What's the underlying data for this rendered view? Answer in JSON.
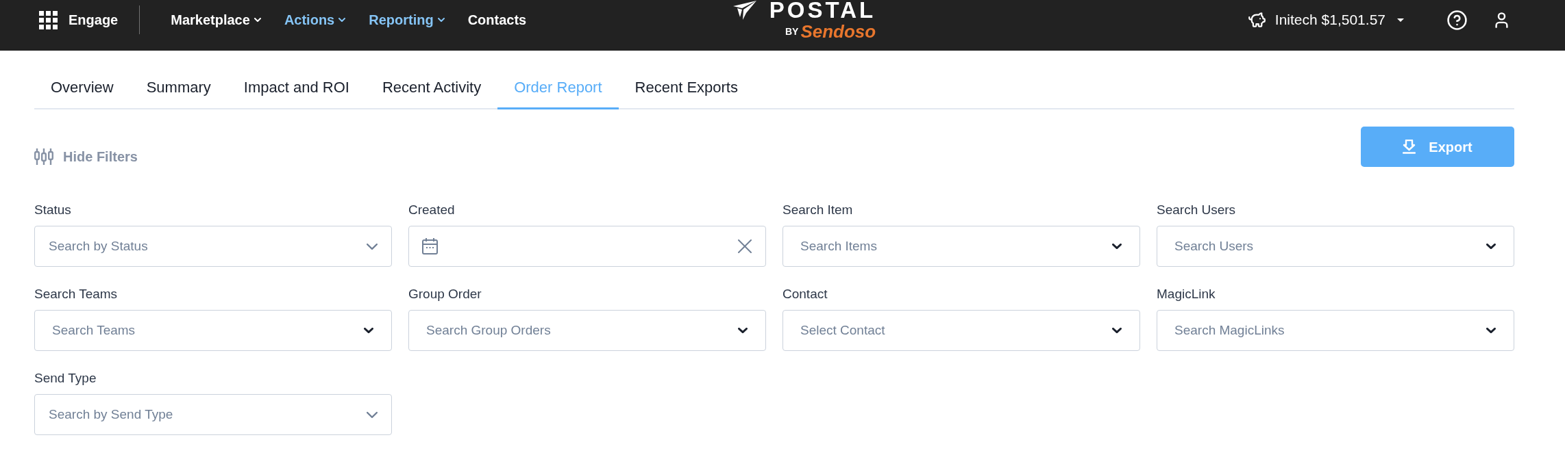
{
  "header": {
    "apps_label": "Engage",
    "nav": [
      {
        "label": "Marketplace",
        "active": false,
        "has_menu": true
      },
      {
        "label": "Actions",
        "active": true,
        "has_menu": true
      },
      {
        "label": "Reporting",
        "active": true,
        "has_menu": true
      },
      {
        "label": "Contacts",
        "active": false,
        "has_menu": false
      }
    ],
    "logo": {
      "wordmark": "POSTAL",
      "by": "BY",
      "brand": "Sendoso"
    },
    "account": {
      "label": "Initech $1,501.57"
    }
  },
  "tabs": [
    {
      "label": "Overview",
      "selected": false
    },
    {
      "label": "Summary",
      "selected": false
    },
    {
      "label": "Impact and ROI",
      "selected": false
    },
    {
      "label": "Recent Activity",
      "selected": false
    },
    {
      "label": "Order Report",
      "selected": true
    },
    {
      "label": "Recent Exports",
      "selected": false
    }
  ],
  "filters_toggle": {
    "label": "Hide Filters"
  },
  "export_button": {
    "label": "Export"
  },
  "filters": [
    {
      "kind": "select",
      "label": "Status",
      "placeholder": "Search by Status"
    },
    {
      "kind": "date",
      "label": "Created"
    },
    {
      "kind": "combobox",
      "label": "Search Item",
      "placeholder": "Search Items"
    },
    {
      "kind": "combobox",
      "label": "Search Users",
      "placeholder": "Search Users"
    },
    {
      "kind": "combobox",
      "label": "Search Teams",
      "placeholder": "Search Teams"
    },
    {
      "kind": "combobox",
      "label": "Group Order",
      "placeholder": "Search Group Orders"
    },
    {
      "kind": "combobox",
      "label": "Contact",
      "placeholder": "Select Contact"
    },
    {
      "kind": "combobox",
      "label": "MagicLink",
      "placeholder": "Search MagicLinks"
    },
    {
      "kind": "select",
      "label": "Send Type",
      "placeholder": "Search by Send Type"
    }
  ]
}
